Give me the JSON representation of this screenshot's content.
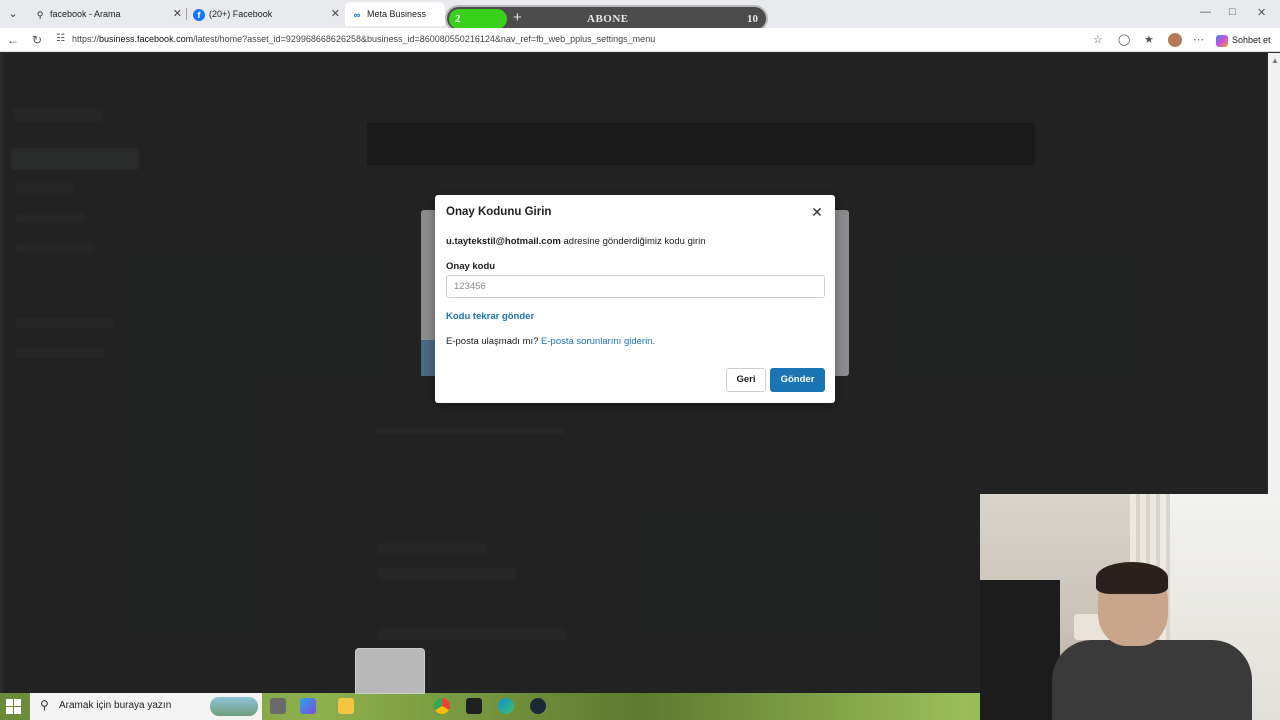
{
  "browser": {
    "tabs": [
      {
        "label": "facebook - Arama",
        "icon": "search-icon"
      },
      {
        "label": "(20+) Facebook",
        "icon": "facebook-icon"
      },
      {
        "label": "Meta Business Suite",
        "icon": "meta-icon"
      }
    ],
    "url": "https://business.facebook.com/latest/home?asset_id=929968668626258&business_id=860080550216124&nav_ref=fb_web_pplus_settings_menu",
    "url_domain": "business.facebook.com",
    "copilot_label": "Sohbet et"
  },
  "overlay": {
    "left_count": "2",
    "label": "ABONE",
    "right_count": "10"
  },
  "modal": {
    "title": "Onay Kodunu Girin",
    "email": "u.taytekstil@hotmail.com",
    "desc_suffix": " adresine gönderdiğimiz kodu girin",
    "code_label": "Onay kodu",
    "code_placeholder": "123456",
    "code_value": "",
    "resend_link": "Kodu tekrar gönder",
    "email_help_prefix": "E-posta ulaşmadı mı? ",
    "email_help_link": "E-posta sorunlarını giderin.",
    "back_button": "Geri",
    "send_button": "Gönder"
  },
  "taskbar": {
    "search_placeholder": "Aramak için buraya yazın"
  },
  "colors": {
    "primary": "#1b74b4",
    "overlay_green": "#39d11c"
  }
}
